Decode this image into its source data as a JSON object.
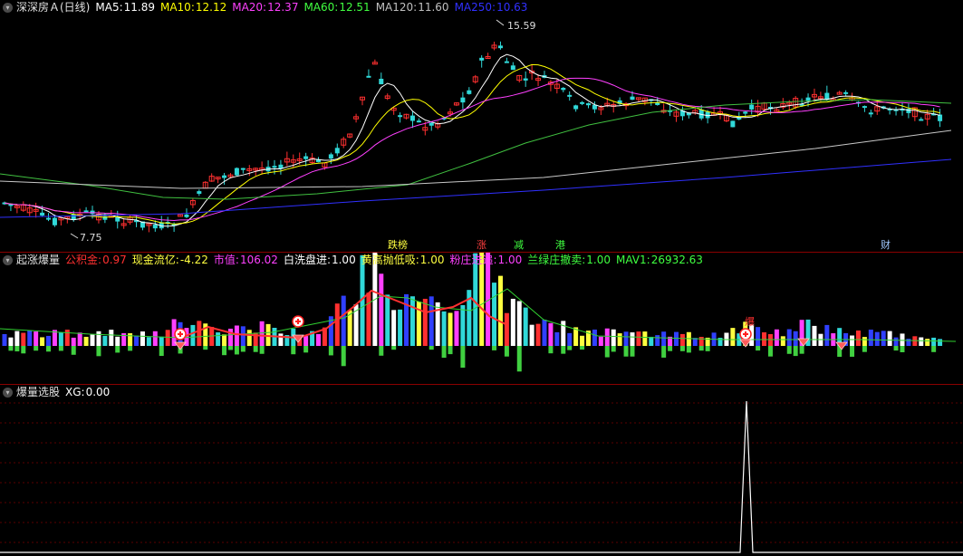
{
  "main": {
    "title": "深深房Ａ(日线)",
    "ma": [
      {
        "label": "MA5:",
        "value": "11.89",
        "color": "#ffffff"
      },
      {
        "label": "MA10:",
        "value": "12.12",
        "color": "#ffff00"
      },
      {
        "label": "MA20:",
        "value": "12.37",
        "color": "#ff40ff"
      },
      {
        "label": "MA60:",
        "value": "12.51",
        "color": "#40ff40"
      },
      {
        "label": "MA120:",
        "value": "11.60",
        "color": "#c0c0c0"
      },
      {
        "label": "MA250:",
        "value": "10.63",
        "color": "#3030ff"
      }
    ],
    "high_label": "15.59",
    "low_label": "7.75",
    "events": [
      {
        "text": "跌榜",
        "color": "#ffff40"
      },
      {
        "text": "涨",
        "color": "#ff4040"
      },
      {
        "text": "减",
        "color": "#40ff40"
      },
      {
        "text": "港",
        "color": "#40ff40"
      },
      {
        "text": "财",
        "color": "#a0c8ff"
      }
    ]
  },
  "indicator1": {
    "title": "起涨爆量",
    "items": [
      {
        "label": "公积金:",
        "value": "0.97",
        "color": "#ff3030"
      },
      {
        "label": "现金流亿:",
        "value": "-4.22",
        "color": "#ffff40"
      },
      {
        "label": "市值:",
        "value": "106.02",
        "color": "#ff40ff"
      },
      {
        "label": "白洗盘进:",
        "value": "1.00",
        "color": "#ffffff"
      },
      {
        "label": "黄高抛低吸:",
        "value": "1.00",
        "color": "#ffff40"
      },
      {
        "label": "粉庄进追:",
        "value": "1.00",
        "color": "#ff40ff"
      },
      {
        "label": "兰绿庄撤卖:",
        "value": "1.00",
        "color": "#40ff40"
      },
      {
        "label": "MAV1:",
        "value": "26932.63",
        "color": "#40ff40"
      }
    ],
    "signal_glyph": "爆"
  },
  "indicator2": {
    "title": "爆量选股",
    "items": [
      {
        "label": "XG:",
        "value": "0.00",
        "color": "#ffffff"
      }
    ]
  }
}
